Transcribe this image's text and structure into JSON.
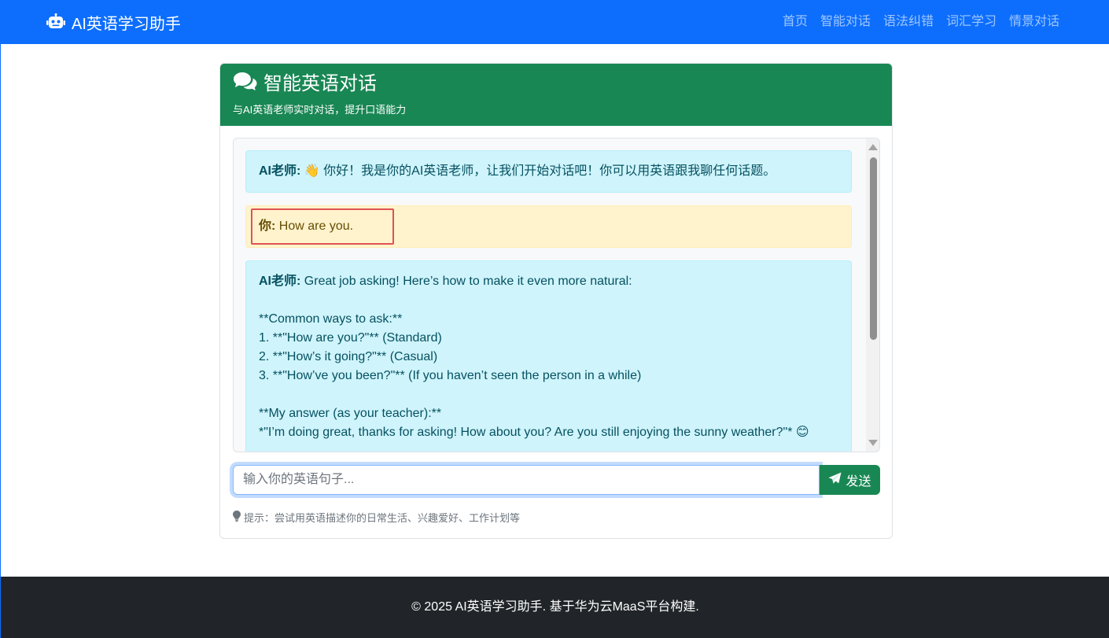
{
  "navbar": {
    "brand": "AI英语学习助手",
    "brand_icon": "robot-icon",
    "links": [
      "首页",
      "智能对话",
      "语法纠错",
      "词汇学习",
      "情景对话"
    ]
  },
  "card": {
    "title": "智能英语对话",
    "title_icon": "comments-icon",
    "subtitle": "与AI英语老师实时对话，提升口语能力"
  },
  "messages": [
    {
      "role": "ai",
      "speaker": "AI老师:",
      "text": " 👋 你好！我是你的AI英语老师，让我们开始对话吧！你可以用英语跟我聊任何话题。"
    },
    {
      "role": "user",
      "speaker": "你:",
      "text": " How are you."
    },
    {
      "role": "ai",
      "speaker": "AI老师:",
      "text": " Great job asking! Here’s how to make it even more natural:\n\n**Common ways to ask:**\n1. **\"How are you?\"** (Standard)\n2. **\"How’s it going?\"** (Casual)\n3. **\"How’ve you been?\"** (If you haven’t seen the person in a while)\n\n**My answer (as your teacher):**\n*\"I’m doing great, thanks for asking! How about you? Are you still enjoying the sunny weather?\"* 😊"
    }
  ],
  "input": {
    "placeholder": "输入你的英语句子...",
    "value": ""
  },
  "send_button": {
    "label": "发送",
    "icon": "paper-plane-icon"
  },
  "hint": {
    "icon": "lightbulb-icon",
    "text": "提示：尝试用英语描述你的日常生活、兴趣爱好、工作计划等"
  },
  "footer": {
    "text": "© 2025 AI英语学习助手. 基于华为云MaaS平台构建."
  },
  "colors": {
    "primary": "#0d6efd",
    "success": "#198754",
    "ai_bubble": "#cff4fc",
    "user_bubble": "#fff3cd",
    "footer_bg": "#212529",
    "highlight": "#e05252"
  }
}
